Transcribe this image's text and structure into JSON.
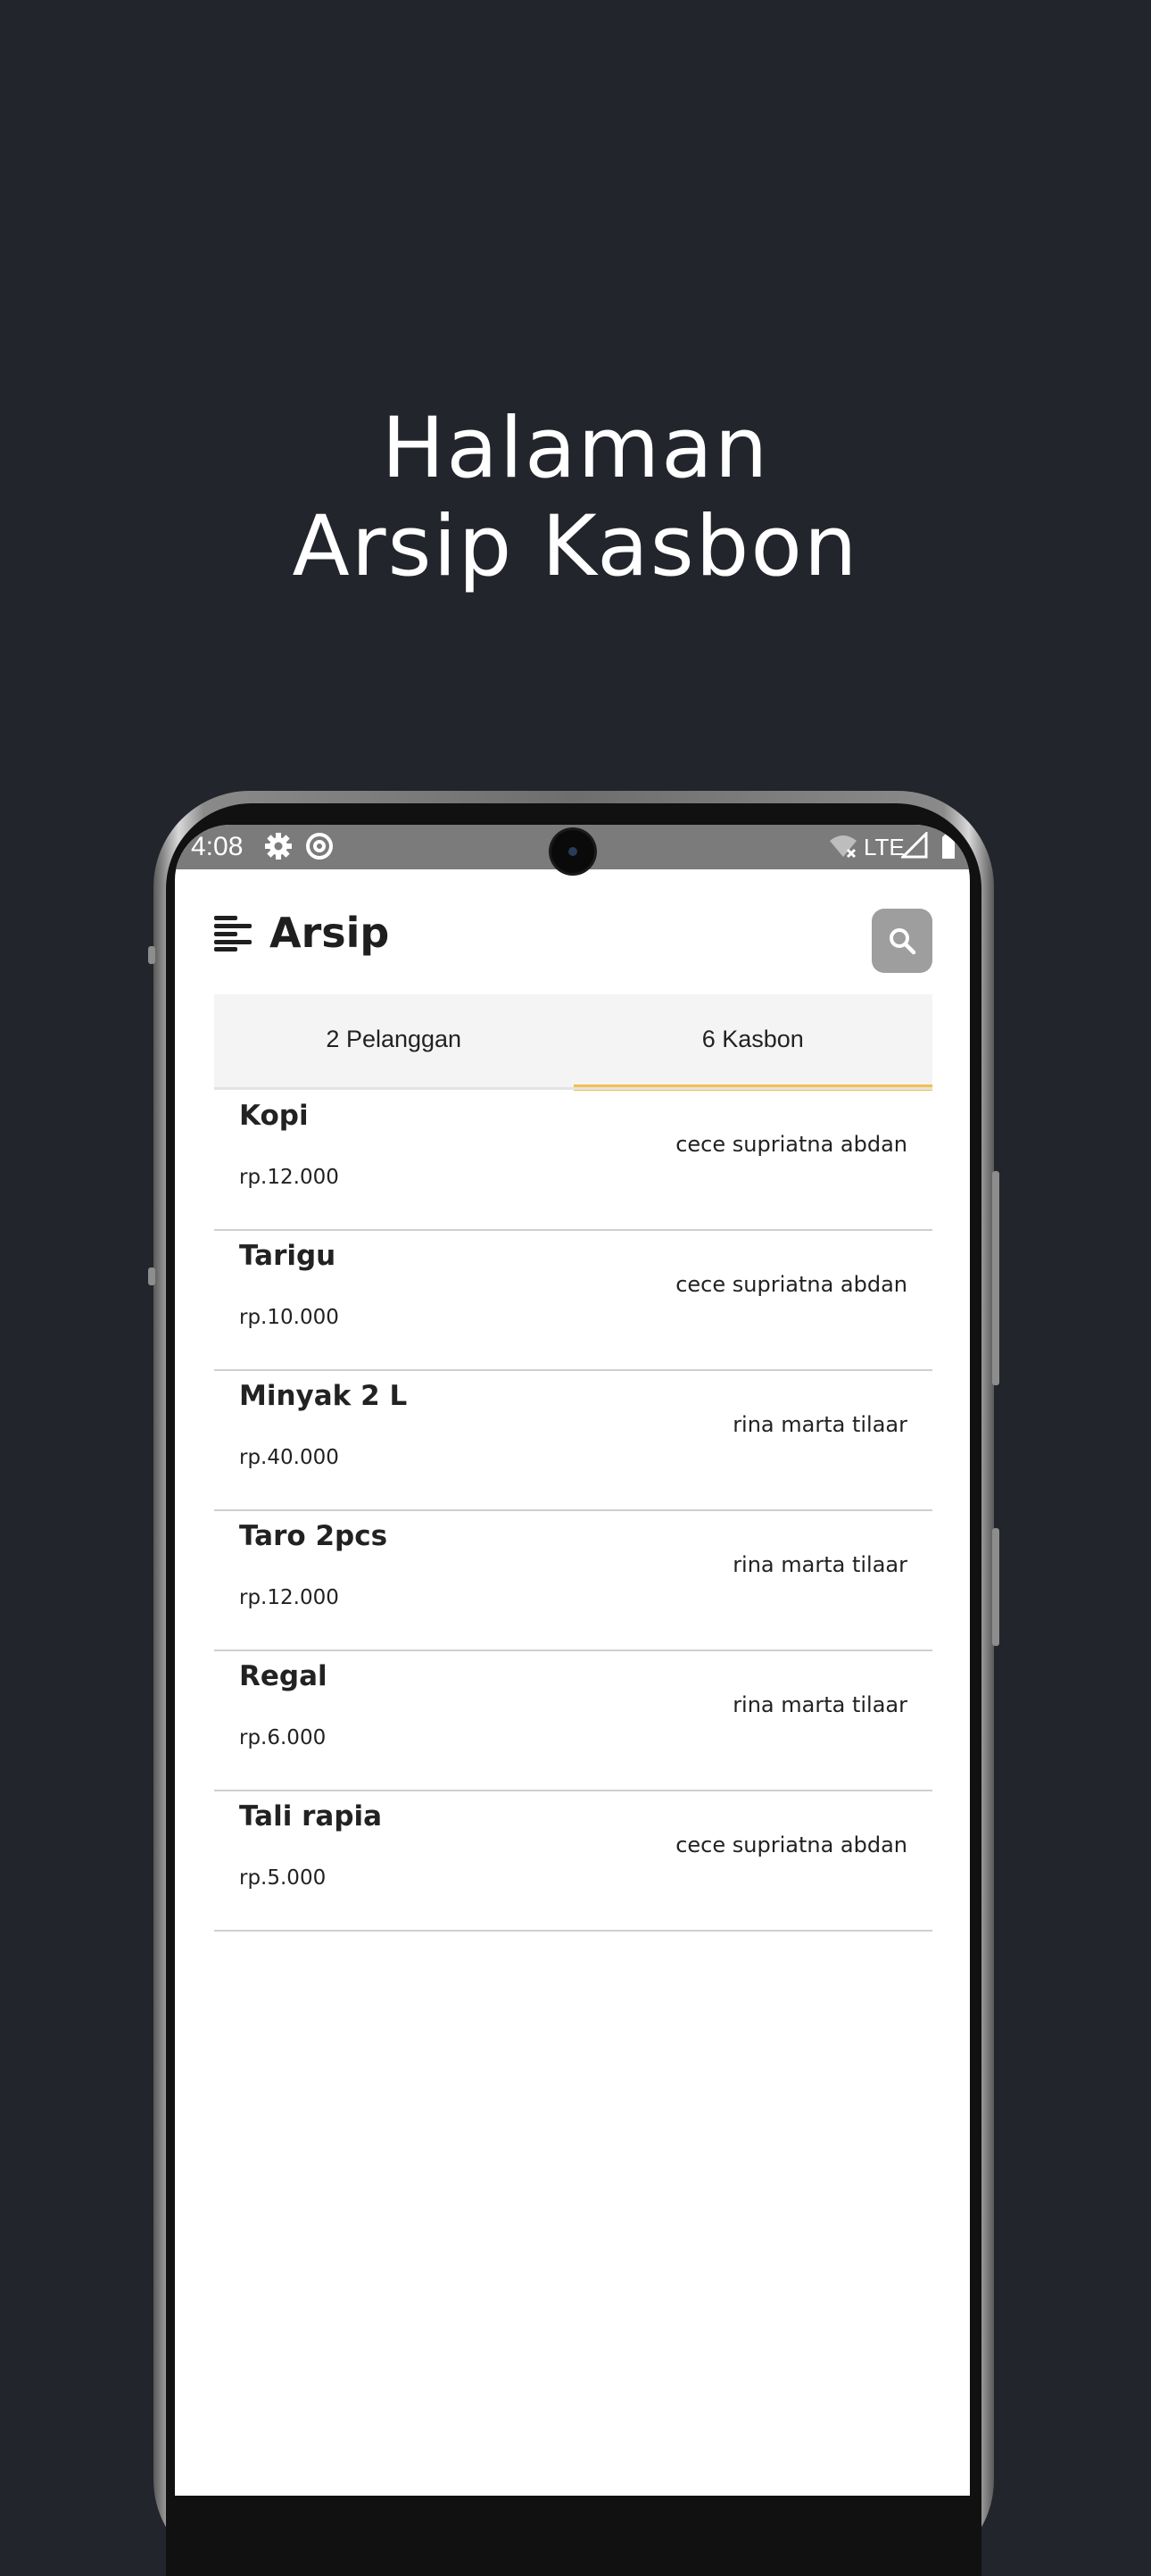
{
  "promo": {
    "line1": "Halaman",
    "line2": "Arsip Kasbon"
  },
  "statusbar": {
    "time": "4:08",
    "network": "LTE",
    "icons": [
      "settings-icon",
      "at-sign-icon",
      "wifi-off-icon",
      "signal-icon",
      "battery-icon"
    ]
  },
  "appbar": {
    "title": "Arsip",
    "menu_icon": "menu-icon",
    "search_icon": "search-icon"
  },
  "tabs": [
    {
      "label": "2 Pelanggan",
      "active": false
    },
    {
      "label": "6 Kasbon",
      "active": true
    }
  ],
  "colors": {
    "background": "#22252c",
    "accent": "#f2c04a",
    "statusbar": "#7b7b7b",
    "search_button": "#9e9e9e"
  },
  "items": [
    {
      "name": "Kopi",
      "amount": "rp.12.000",
      "customer": "cece supriatna abdan"
    },
    {
      "name": "Tarigu",
      "amount": "rp.10.000",
      "customer": "cece supriatna abdan"
    },
    {
      "name": "Minyak 2 L",
      "amount": "rp.40.000",
      "customer": "rina marta tilaar"
    },
    {
      "name": "Taro 2pcs",
      "amount": "rp.12.000",
      "customer": "rina marta tilaar"
    },
    {
      "name": "Regal",
      "amount": "rp.6.000",
      "customer": "rina marta tilaar"
    },
    {
      "name": "Tali rapia",
      "amount": "rp.5.000",
      "customer": "cece supriatna abdan"
    }
  ]
}
